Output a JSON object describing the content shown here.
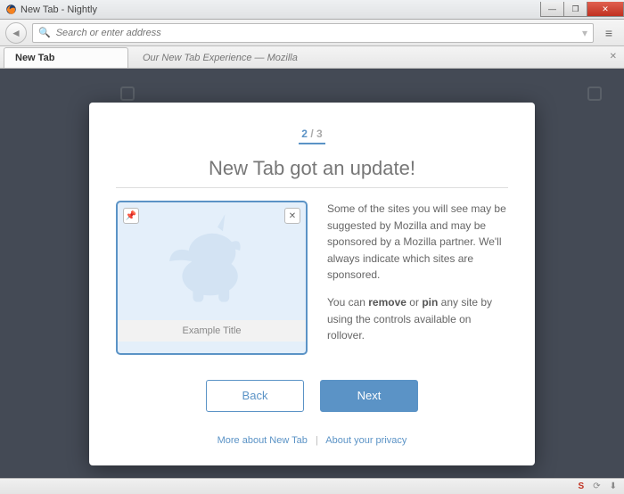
{
  "window": {
    "title": "New Tab - Nightly"
  },
  "urlbar": {
    "placeholder": "Search or enter address"
  },
  "tabs": {
    "active": "New Tab",
    "background": "Our New Tab Experience — Mozilla"
  },
  "modal": {
    "step_current": "2",
    "step_total": "3",
    "step_sep": " / ",
    "heading": "New Tab got an update!",
    "thumb_title": "Example Title",
    "desc1": "Some of the sites you will see may be suggested by Mozilla and may be sponsored by a Mozilla partner. We'll always indicate which sites are sponsored.",
    "desc2_pre": "You can ",
    "desc2_b1": "remove",
    "desc2_mid": " or ",
    "desc2_b2": "pin",
    "desc2_post": " any site by using the controls available on rollover.",
    "back": "Back",
    "next": "Next",
    "link1": "More about New Tab",
    "link2": "About your privacy"
  },
  "status": {
    "s": "S"
  }
}
